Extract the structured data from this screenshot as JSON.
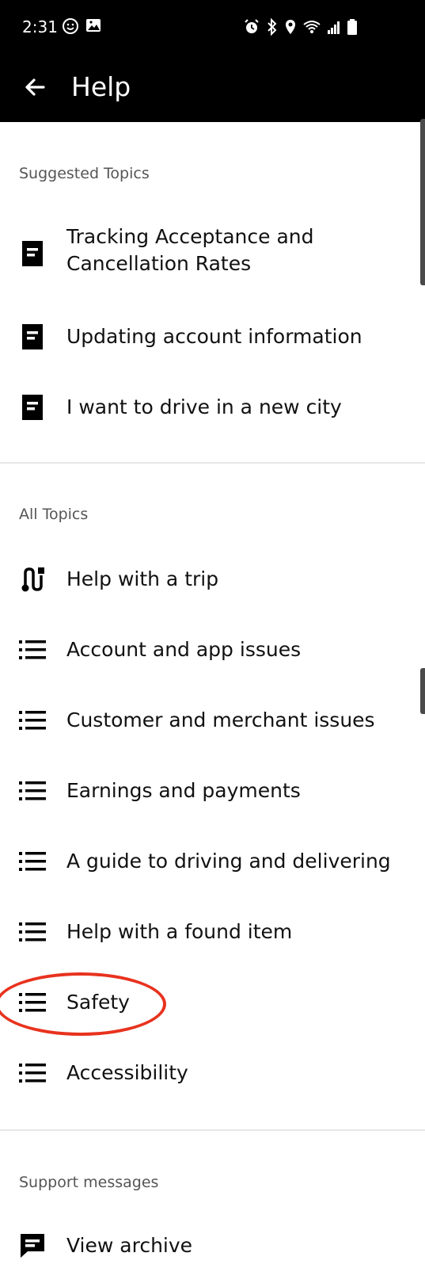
{
  "status_bar": {
    "time": "2:31",
    "icons_left": [
      "face-icon",
      "image-icon"
    ],
    "icons_right": [
      "alarm-icon",
      "bluetooth-icon",
      "location-icon",
      "wifi-icon",
      "signal-icon",
      "battery-icon"
    ]
  },
  "app_bar": {
    "back_icon": "arrow-left-icon",
    "title": "Help"
  },
  "suggested": {
    "label": "Suggested Topics",
    "items": [
      {
        "icon": "article-icon",
        "label_line1": "Tracking Acceptance and",
        "label_line2": "Cancellation Rates"
      },
      {
        "icon": "article-icon",
        "label": "Updating account information"
      },
      {
        "icon": "article-icon",
        "label": "I want to drive in a new city"
      }
    ]
  },
  "all_topics": {
    "label": "All Topics",
    "items": [
      {
        "icon": "route-icon",
        "label": "Help with a trip"
      },
      {
        "icon": "list-icon",
        "label": "Account and app issues"
      },
      {
        "icon": "list-icon",
        "label": "Customer and merchant issues"
      },
      {
        "icon": "list-icon",
        "label": "Earnings and payments"
      },
      {
        "icon": "list-icon",
        "label": "A guide to driving and delivering"
      },
      {
        "icon": "list-icon",
        "label": "Help with a found item"
      },
      {
        "icon": "list-icon",
        "label": "Safety"
      },
      {
        "icon": "list-icon",
        "label": "Accessibility"
      }
    ]
  },
  "support": {
    "label": "Support messages",
    "items": [
      {
        "icon": "message-icon",
        "label": "View archive"
      }
    ]
  },
  "colors": {
    "bar_bg": "#000000",
    "highlight": "#e8321e",
    "label_gray": "#555555"
  }
}
